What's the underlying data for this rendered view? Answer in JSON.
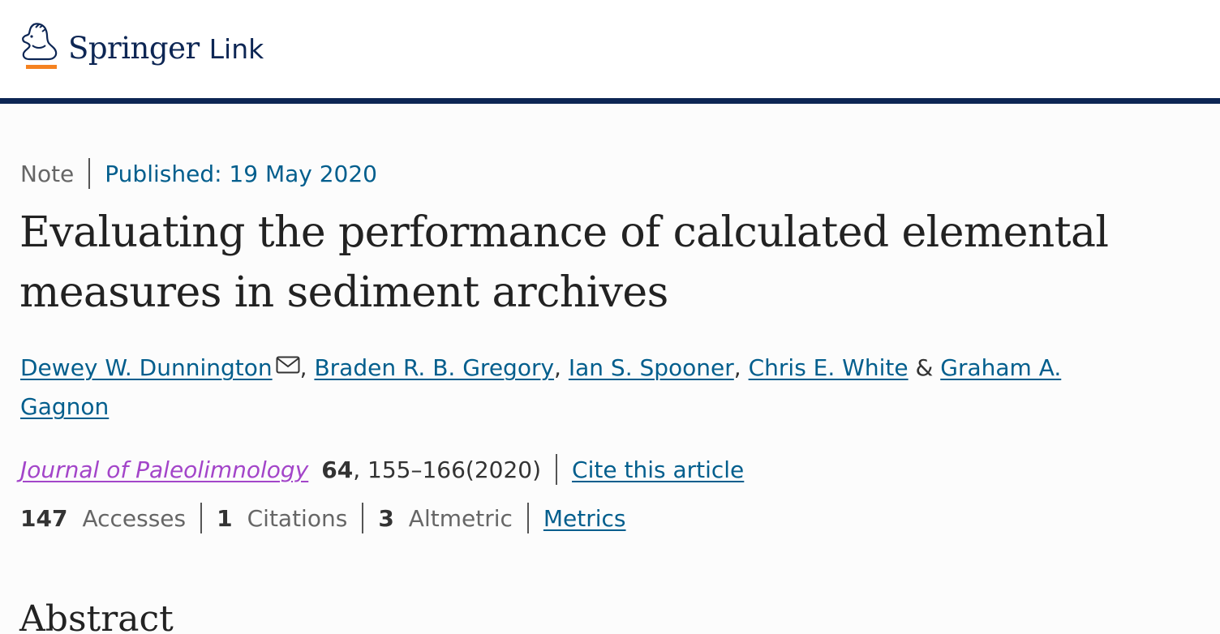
{
  "header": {
    "logo_primary": "Springer",
    "logo_secondary": "Link",
    "logo_icon": "springer-horse-icon",
    "colors": {
      "brand": "#0d2654",
      "accent": "#f58220"
    }
  },
  "article": {
    "type": "Note",
    "published": "Published: 19 May 2020",
    "title": "Evaluating the performance of calculated elemental measures in sediment archives",
    "authors": [
      {
        "name": "Dewey W. Dunnington"
      },
      {
        "name": "Braden R. B. Gregory"
      },
      {
        "name": "Ian S. Spooner"
      },
      {
        "name": "Chris E. White"
      },
      {
        "name": "Graham A. Gagnon"
      }
    ],
    "author_separators": {
      "comma": ",",
      "and": "&"
    },
    "email_icon": "envelope-icon",
    "journal": "Journal of Paleolimnology",
    "volume": "64",
    "pages": ", 155–166(2020)",
    "cite_label": "Cite this article",
    "metrics": {
      "accesses_count": "147",
      "accesses_label": "Accesses",
      "citations_count": "1",
      "citations_label": "Citations",
      "altmetric_count": "3",
      "altmetric_label": "Altmetric",
      "metrics_link": "Metrics"
    },
    "abstract_heading": "Abstract",
    "colors": {
      "link": "#025e8d",
      "journal_link": "#a345c9",
      "text": "#333333"
    }
  }
}
